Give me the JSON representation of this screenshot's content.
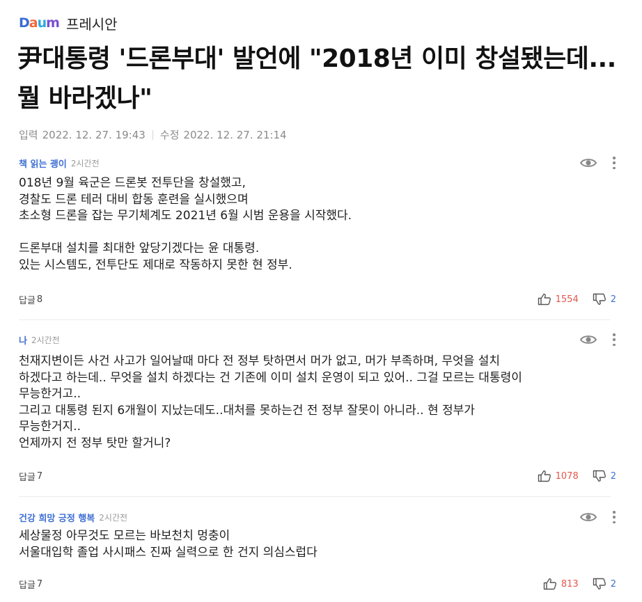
{
  "header": {
    "logo_text": "Daum",
    "publisher": "프레시안"
  },
  "article": {
    "title": "尹대통령 '드론부대' 발언에 \"2018년 이미 창설됐는데...뭘 바라겠나\"",
    "input_label": "입력",
    "input_date": "2022. 12. 27. 19:43",
    "edit_label": "수정",
    "edit_date": "2022. 12. 27. 21:14"
  },
  "comments": [
    {
      "nickname": "책 읽는 괭이",
      "time": "2시간전",
      "text": "018년 9월 육군은 드론봇 전투단을 창설했고,\n경찰도 드론 테러 대비 합동 훈련을 실시했으며\n초소형 드론을 잡는 무기체계도 2021년 6월 시범 운용을 시작했다.\n\n드론부대 설치를 최대한 앞당기겠다는 윤 대통령.\n있는 시스템도, 전투단도 제대로 작동하지 못한 현 정부.",
      "reply_label": "답글",
      "reply_count": "8",
      "likes": "1554",
      "dislikes": "2"
    },
    {
      "nickname": "나",
      "time": "2시간전",
      "text": "천재지변이든 사건 사고가 일어날때 마다 전 정부 탓하면서 머가 없고, 머가 부족하며, 무엇을 설치\n하겠다고 하는데.. 무엇을 설치 하겠다는 건 기존에 이미 설치 운영이 되고 있어.. 그걸 모르는 대통령이\n무능한거고..\n그리고 대통령 된지 6개월이 지났는데도..대처를 못하는건 전 정부 잘못이 아니라.. 현 정부가\n무능한거지..\n언제까지 전 정부 탓만 할거니?",
      "reply_label": "답글",
      "reply_count": "7",
      "likes": "1078",
      "dislikes": "2"
    },
    {
      "nickname": "건강 희망 긍정 행복",
      "time": "2시간전",
      "text": "세상물정 아무것도 모르는 바보천치 멍충이\n서울대입학 졸업 사시패스 진짜 실력으로 한 건지 의심스럽다",
      "reply_label": "답글",
      "reply_count": "7",
      "likes": "813",
      "dislikes": "2"
    }
  ],
  "icons": {
    "eye": "eye-icon",
    "more": "more-vertical-icon",
    "thumbs_up": "thumbs-up-icon",
    "thumbs_down": "thumbs-down-icon"
  },
  "colors": {
    "nickname": "#3f6fd3",
    "likes": "#e2574c",
    "dislikes": "#3f6fd3",
    "logo_d": "#3b6bd6",
    "logo_a": "#f0683a",
    "logo_u": "#2aa9e0",
    "logo_m": "#7a4fd4"
  }
}
